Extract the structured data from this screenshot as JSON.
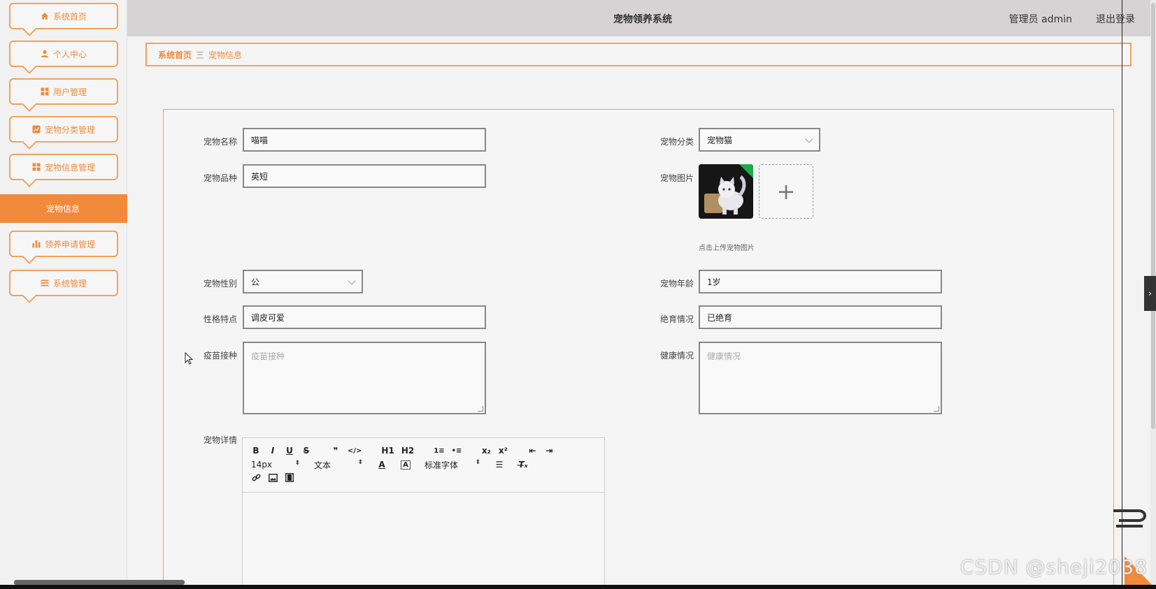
{
  "app": {
    "title": "宠物领养系统",
    "user": "管理员 admin",
    "logout": "退出登录"
  },
  "sidebar": {
    "items": [
      {
        "label": "系统首页",
        "icon": "home-icon"
      },
      {
        "label": "个人中心",
        "icon": "user-icon"
      },
      {
        "label": "用户管理",
        "icon": "grid-icon"
      },
      {
        "label": "宠物分类管理",
        "icon": "chart-box-icon"
      },
      {
        "label": "宠物信息管理",
        "icon": "grid-icon"
      },
      {
        "label": "领养申请管理",
        "icon": "bar-chart-icon"
      },
      {
        "label": "系统管理",
        "icon": "list-icon"
      }
    ],
    "active_sub": "宠物信息"
  },
  "breadcrumb": {
    "home": "系统首页",
    "separator": "三",
    "current": "宠物信息"
  },
  "form": {
    "pet_name": {
      "label": "宠物名称",
      "value": "喵喵"
    },
    "pet_category": {
      "label": "宠物分类",
      "value": "宠物猫"
    },
    "pet_breed": {
      "label": "宠物品种",
      "value": "英短"
    },
    "pet_image": {
      "label": "宠物图片",
      "tip": "点击上传宠物图片",
      "add_symbol": "+"
    },
    "pet_gender": {
      "label": "宠物性别",
      "value": "公"
    },
    "pet_age": {
      "label": "宠物年龄",
      "value": "1岁"
    },
    "personality": {
      "label": "性格特点",
      "value": "调皮可爱"
    },
    "sterilization": {
      "label": "绝育情况",
      "value": "已绝育"
    },
    "vaccination": {
      "label": "疫苗接种",
      "placeholder": "疫苗接种"
    },
    "health": {
      "label": "健康情况",
      "placeholder": "健康情况"
    },
    "details": {
      "label": "宠物详情"
    }
  },
  "editor": {
    "row1": [
      "B",
      "I",
      "U",
      "S",
      "❞",
      "</>",
      "H1",
      "H2",
      "1≡",
      "•≡",
      "x₂",
      "x²",
      "⇤",
      "⇥"
    ],
    "font_size": "14px",
    "block_type": "文本",
    "font_family": "标准字体",
    "row3": [
      "link",
      "image",
      "video"
    ]
  },
  "watermark": "CSDN @sheji2038",
  "colors": {
    "accent": "#f28a3c",
    "border": "#f0a35d",
    "topbar": "#d5d3d3"
  }
}
